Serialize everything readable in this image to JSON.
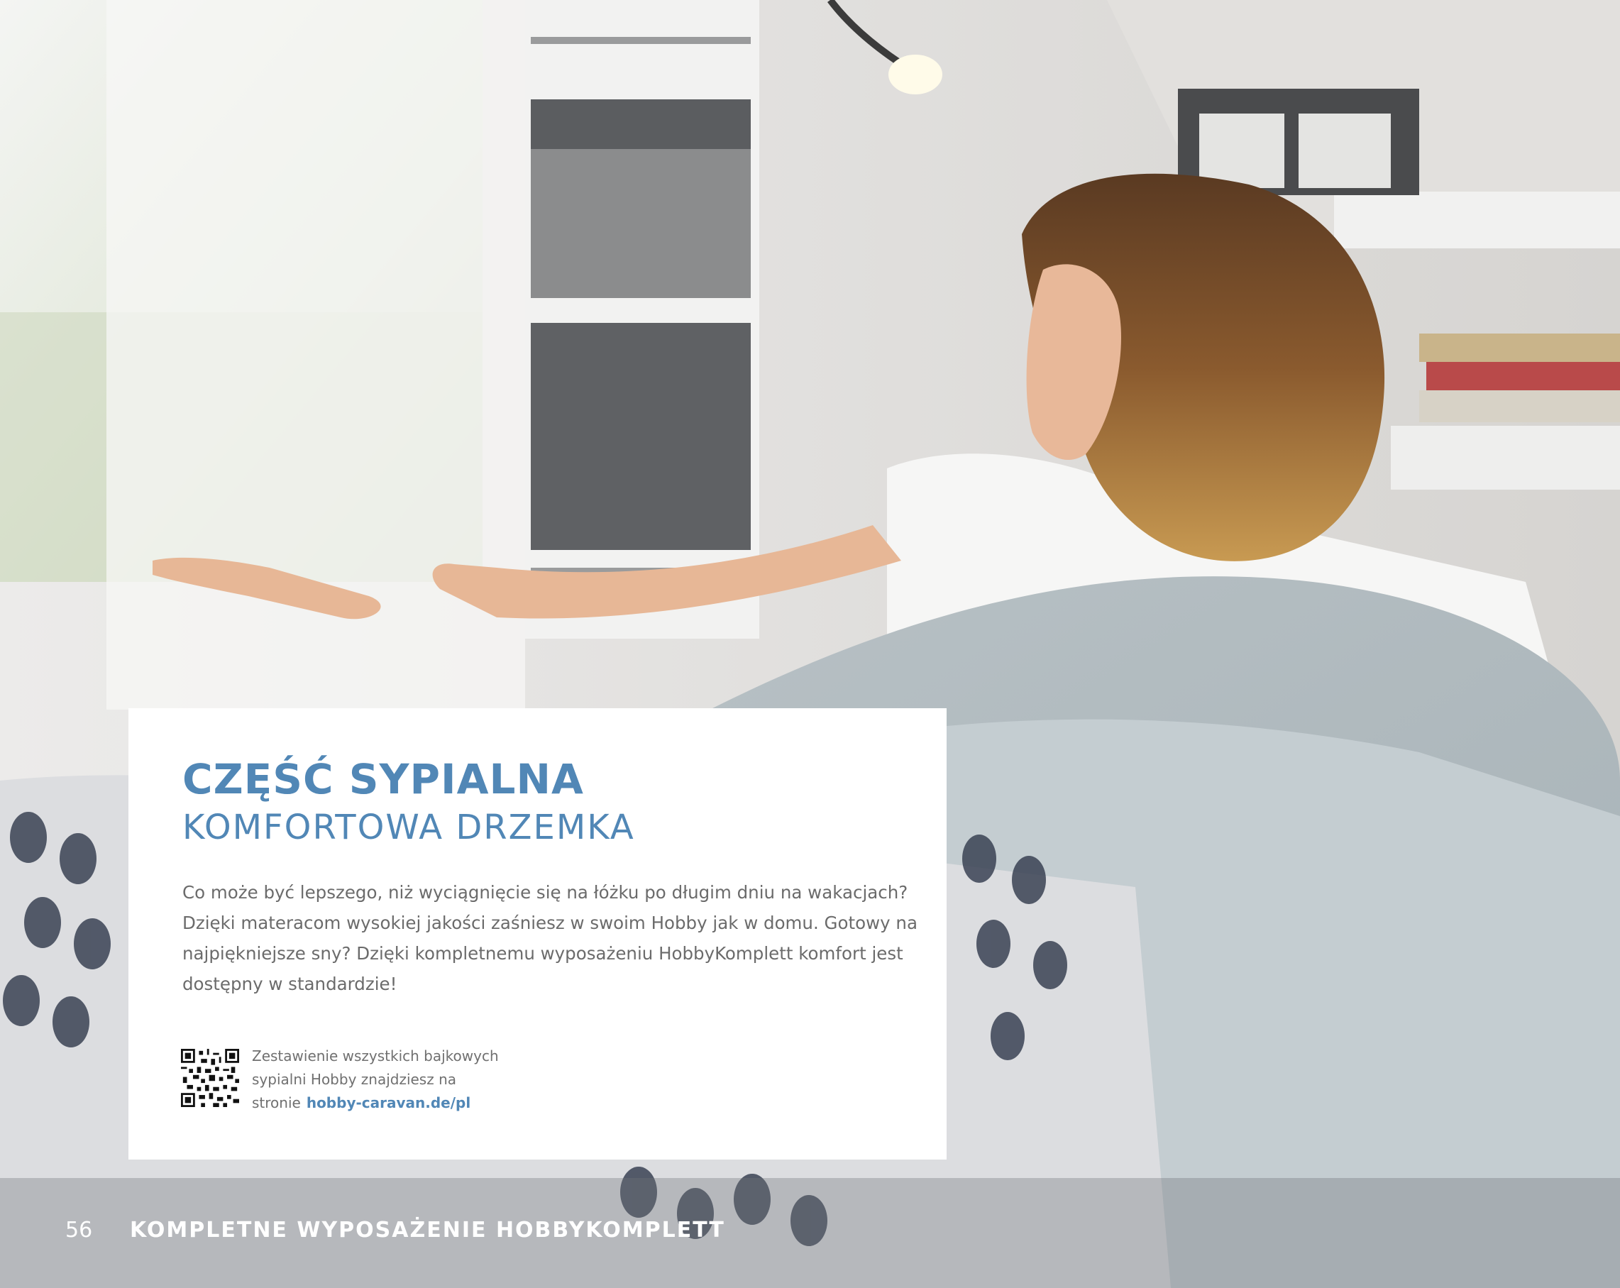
{
  "card": {
    "title": "CZĘŚĆ SYPIALNA",
    "subtitle": "KOMFORTOWA DRZEMKA",
    "body_lines": [
      "Co może być lepszego, niż wyciągnięcie się na łóżku po długim dniu na wakacjach?",
      "Dzięki materacom wysokiej jakości zaśniesz w swoim Hobby jak w domu. Gotowy na",
      "najpiękniejsze sny? Dzięki kompletnemu wyposażeniu HobbyKomplett komfort jest",
      "dostępny w standardzie!"
    ],
    "qr_text_lines": [
      "Zestawienie wszystkich bajkowych",
      "sypialni Hobby znajdziesz na"
    ],
    "qr_text_prefix": "stronie",
    "qr_link": "hobby-caravan.de/pl"
  },
  "footer": {
    "page_number": "56",
    "section_title": "KOMPLETNE WYPOSAŻENIE HOBBYKOMPLETT"
  },
  "colors": {
    "accent": "#5187b6",
    "body_text": "#6b6b6b",
    "card_background": "#ffffff"
  },
  "icons": {
    "qr": "qr-code-icon"
  }
}
